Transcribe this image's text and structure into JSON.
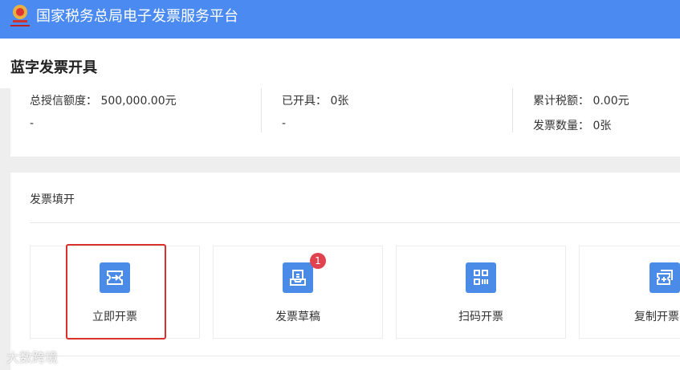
{
  "header": {
    "title": "国家税务总局电子发票服务平台",
    "logo_icon": "tax-emblem-icon"
  },
  "page": {
    "title": "蓝字发票开具"
  },
  "stats": {
    "credit_label": "总授信额度：",
    "credit_value": "500,000.00元",
    "credit_sub": "-",
    "issued_label": "已开具：",
    "issued_value": "0张",
    "issued_sub": "-",
    "tax_label": "累计税额：",
    "tax_value": "0.00元",
    "count_label": "发票数量：",
    "count_value": "0张"
  },
  "section": {
    "title": "发票填开"
  },
  "cards": [
    {
      "label": "立即开票",
      "icon": "invoice-arrow-icon"
    },
    {
      "label": "发票草稿",
      "icon": "draft-tray-icon",
      "badge": "1"
    },
    {
      "label": "扫码开票",
      "icon": "qr-code-icon"
    },
    {
      "label": "复制开票",
      "icon": "copy-invoice-icon"
    }
  ],
  "watermark": "大数跨境",
  "colors": {
    "brand": "#4b8bf1",
    "icon": "#4b8be8",
    "badge": "#e0434f",
    "highlight": "#d9302b"
  }
}
